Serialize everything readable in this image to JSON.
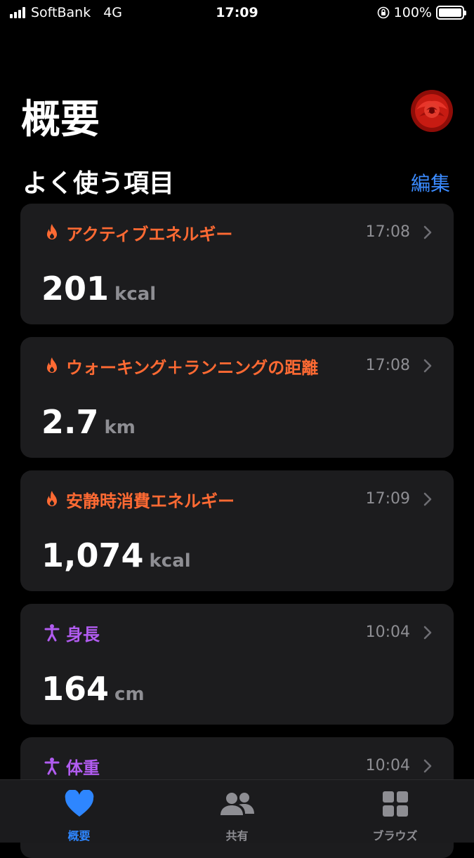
{
  "status_bar": {
    "carrier": "SoftBank",
    "network": "4G",
    "time": "17:09",
    "battery": "100%"
  },
  "header": {
    "title": "概要"
  },
  "favorites": {
    "title": "よく使う項目",
    "edit_label": "編集"
  },
  "cards": [
    {
      "icon": "flame-icon",
      "color": "#ff6a33",
      "title": "アクティブエネルギー",
      "time": "17:08",
      "value": "201",
      "unit": "kcal"
    },
    {
      "icon": "flame-icon",
      "color": "#ff6a33",
      "title": "ウォーキング＋ランニングの距離",
      "time": "17:08",
      "value": "2.7",
      "unit": "km"
    },
    {
      "icon": "flame-icon",
      "color": "#ff6a33",
      "title": "安静時消費エネルギー",
      "time": "17:09",
      "value": "1,074",
      "unit": "kcal"
    },
    {
      "icon": "body-figure-icon",
      "color": "#b15cf0",
      "title": "身長",
      "time": "10:04",
      "value": "164",
      "unit": "cm"
    },
    {
      "icon": "body-figure-icon",
      "color": "#b15cf0",
      "title": "体重",
      "time": "10:04",
      "value": "",
      "unit": ""
    }
  ],
  "tab_bar": {
    "tabs": [
      {
        "label": "概要",
        "icon": "heart-icon",
        "active": true
      },
      {
        "label": "共有",
        "icon": "people-icon",
        "active": false
      },
      {
        "label": "ブラウズ",
        "icon": "grid-icon",
        "active": false
      }
    ]
  },
  "colors": {
    "accent_blue": "#3b8bff",
    "activity_orange": "#ff6a33",
    "body_purple": "#b15cf0",
    "card_bg": "#1c1c1e"
  }
}
